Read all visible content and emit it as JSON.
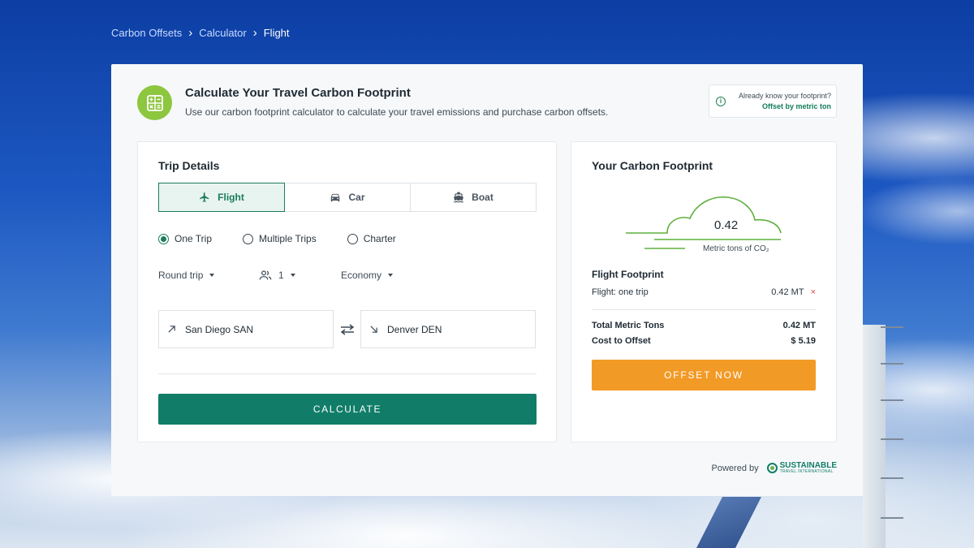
{
  "breadcrumb": {
    "items": [
      "Carbon Offsets",
      "Calculator",
      "Flight"
    ],
    "separator": "›"
  },
  "header": {
    "title": "Calculate Your Travel Carbon Footprint",
    "subtitle": "Use our carbon footprint calculator to calculate your travel emissions and purchase carbon offsets.",
    "icon": "calculator-icon"
  },
  "know_footprint": {
    "question": "Already know your footprint?",
    "link": "Offset by metric ton",
    "icon": "info-icon"
  },
  "trip": {
    "title": "Trip Details",
    "modes": [
      {
        "label": "Flight",
        "icon": "airplane-icon",
        "active": true
      },
      {
        "label": "Car",
        "icon": "car-icon",
        "active": false
      },
      {
        "label": "Boat",
        "icon": "boat-icon",
        "active": false
      }
    ],
    "trip_types": [
      {
        "label": "One Trip",
        "checked": true
      },
      {
        "label": "Multiple Trips",
        "checked": false
      },
      {
        "label": "Charter",
        "checked": false
      }
    ],
    "trip_direction": "Round trip",
    "passengers": "1",
    "cabin_class": "Economy",
    "origin": "San Diego SAN",
    "destination": "Denver DEN",
    "calculate_label": "CALCULATE"
  },
  "footprint": {
    "title": "Your Carbon Footprint",
    "value": "0.42",
    "unit": "Metric tons of CO₂",
    "section_title": "Flight Footprint",
    "line_item_label": "Flight: one trip",
    "line_item_value": "0.42 MT",
    "remove_glyph": "×",
    "total_label": "Total Metric Tons",
    "total_value": "0.42 MT",
    "cost_label": "Cost to Offset",
    "cost_value": "$ 5.19",
    "offset_label": "OFFSET NOW"
  },
  "powered_by": {
    "label": "Powered by",
    "logo_name": "SUSTAINABLE",
    "logo_sub": "TRAVEL INTERNATIONAL"
  },
  "colors": {
    "primary_green": "#117d68",
    "accent_orange": "#f29a26",
    "icon_lime": "#8dc63f"
  }
}
